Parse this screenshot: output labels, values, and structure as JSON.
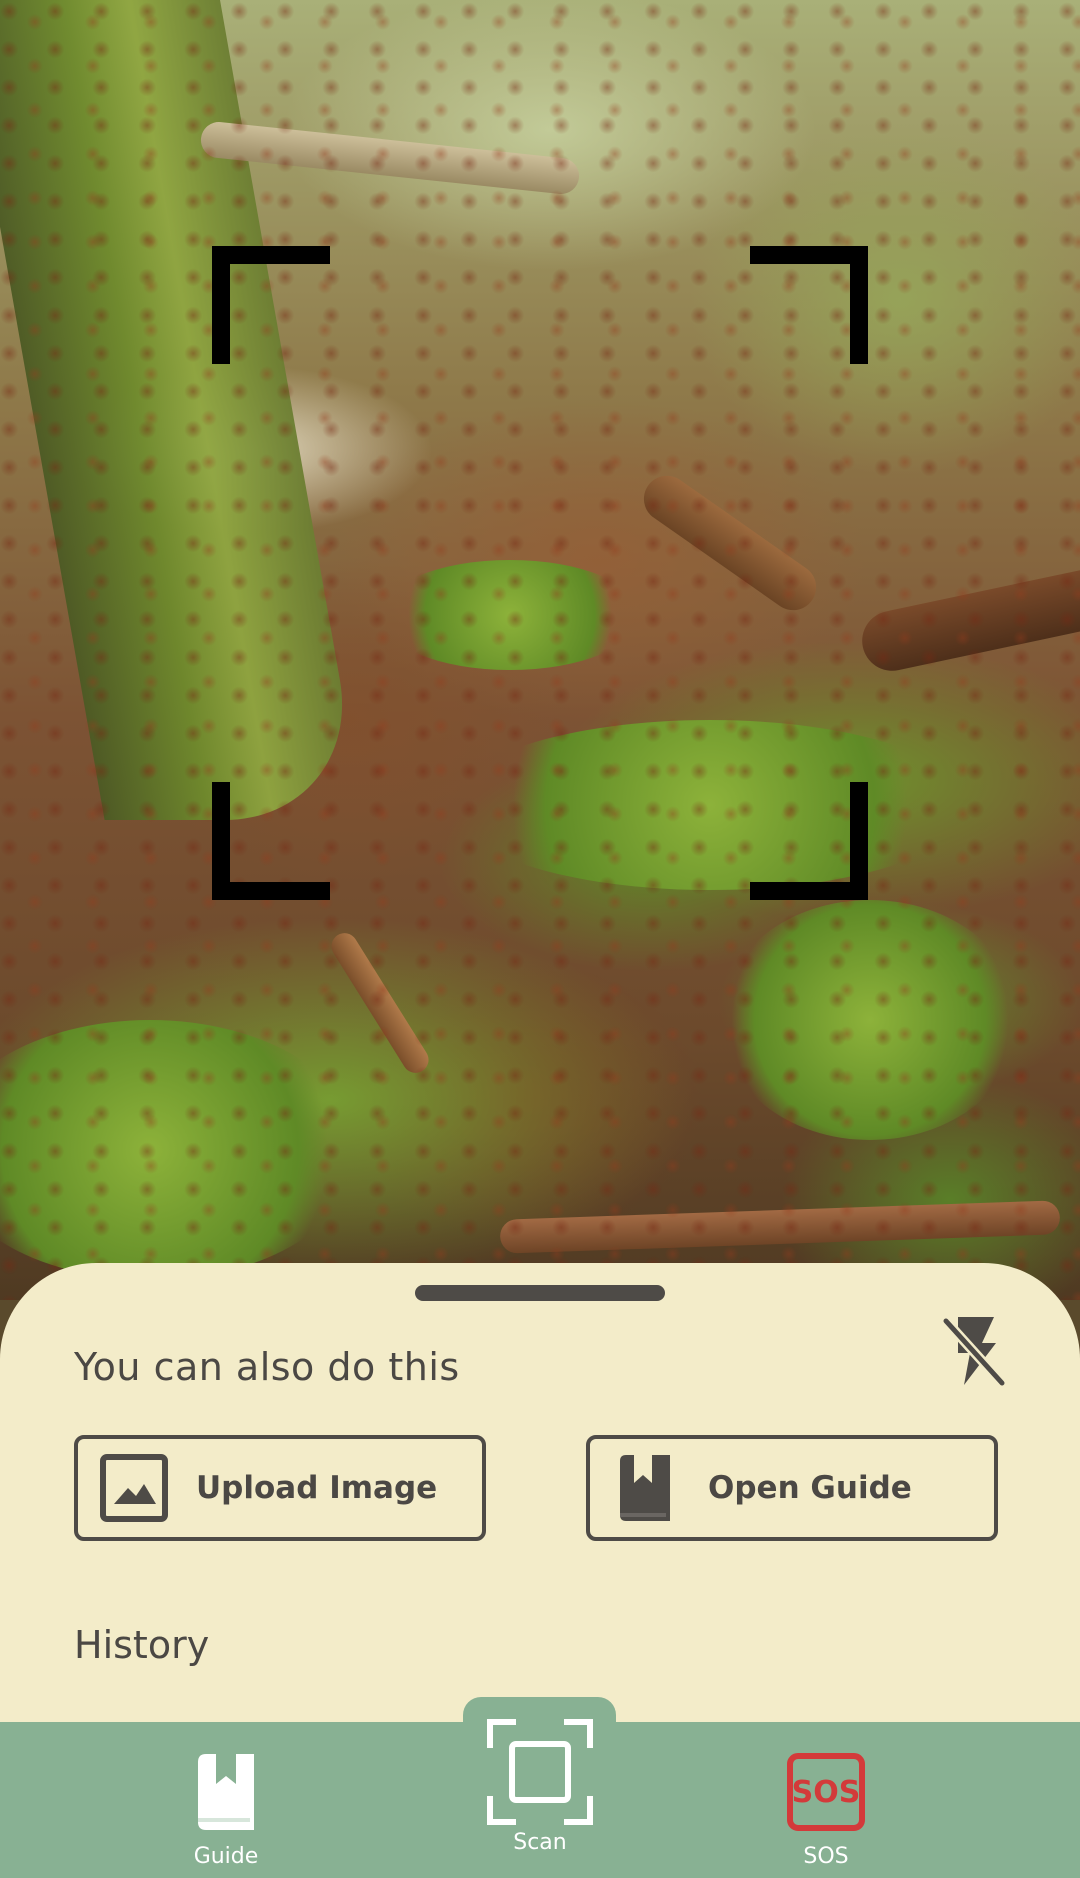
{
  "sheet": {
    "title": "You can also do this",
    "history_title": "History",
    "actions": [
      {
        "label": "Upload Image",
        "icon": "image-icon"
      },
      {
        "label": "Open Guide",
        "icon": "book-icon"
      }
    ],
    "flash_icon": "flash-off-icon"
  },
  "nav": {
    "items": [
      {
        "label": "Guide",
        "icon": "book-icon"
      },
      {
        "label": "Scan",
        "icon": "scan-icon"
      },
      {
        "label": "SOS",
        "icon": "sos-icon"
      }
    ],
    "sos_icon_text": "SOS"
  },
  "colors": {
    "sheet_background": "#f3ecc9",
    "nav_background": "#88b193",
    "text_dark": "#4b4844",
    "sos_red": "#d33a3a",
    "scan_frame": "#000000"
  }
}
